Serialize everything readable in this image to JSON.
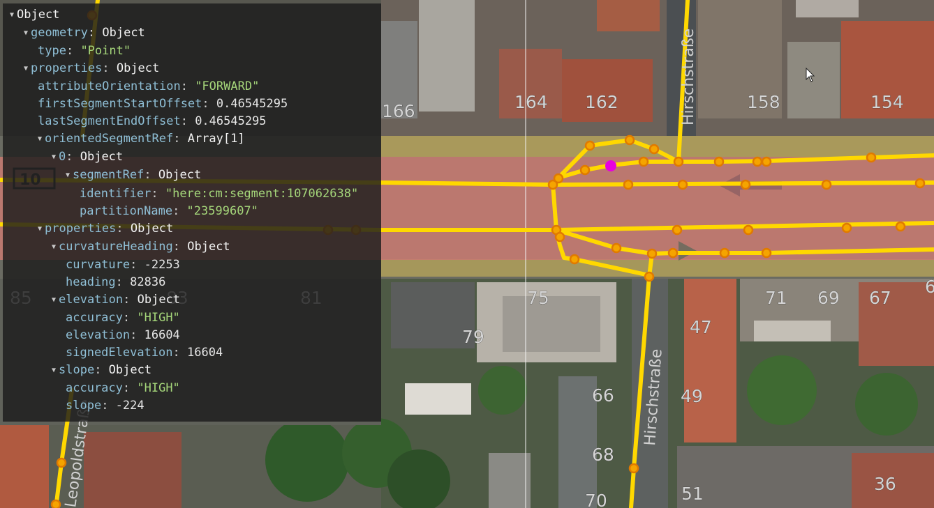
{
  "inspector": {
    "root": "Object",
    "geometry_key": "geometry",
    "geometry_val": "Object",
    "type_key": "type",
    "type_val": "\"Point\"",
    "properties_key": "properties",
    "properties_val": "Object",
    "attr_orient_key": "attributeOrientation",
    "attr_orient_val": "\"FORWARD\"",
    "first_seg_key": "firstSegmentStartOffset",
    "first_seg_val": "0.46545295",
    "last_seg_key": "lastSegmentEndOffset",
    "last_seg_val": "0.46545295",
    "oriented_key": "orientedSegmentRef",
    "oriented_val": "Array[1]",
    "idx0_key": "0",
    "idx0_val": "Object",
    "segref_key": "segmentRef",
    "segref_val": "Object",
    "identifier_key": "identifier",
    "identifier_val": "\"here:cm:segment:107062638\"",
    "partition_key": "partitionName",
    "partition_val": "\"23599607\"",
    "properties2_key": "properties",
    "properties2_val": "Object",
    "curvh_key": "curvatureHeading",
    "curvh_val": "Object",
    "curvature_key": "curvature",
    "curvature_val": "-2253",
    "heading_key": "heading",
    "heading_val": "82836",
    "elevation_obj_key": "elevation",
    "elevation_obj_val": "Object",
    "elev_acc_key": "accuracy",
    "elev_acc_val": "\"HIGH\"",
    "elev_key": "elevation",
    "elev_val": "16604",
    "signed_elev_key": "signedElevation",
    "signed_elev_val": "16604",
    "slope_obj_key": "slope",
    "slope_obj_val": "Object",
    "slope_acc_key": "accuracy",
    "slope_acc_val": "\"HIGH\"",
    "slope_key": "slope",
    "slope_val": "-224"
  },
  "map": {
    "house_numbers": [
      "166",
      "164",
      "162",
      "158",
      "154",
      "75",
      "79",
      "71",
      "69",
      "67",
      "47",
      "49",
      "66",
      "68",
      "70",
      "51",
      "36",
      "85",
      "81",
      "83",
      "6",
      "10"
    ],
    "street_labels": [
      "Hirschstraße",
      "Hirschstraße",
      "Leopoldstraße"
    ],
    "colors": {
      "road": "#ffd800",
      "node_fill": "#f5a400",
      "node_stroke": "#e07a00",
      "selected_point": "#e800e0",
      "road_highlight": "#e0716a",
      "edge_band": "#d9b74a"
    }
  }
}
